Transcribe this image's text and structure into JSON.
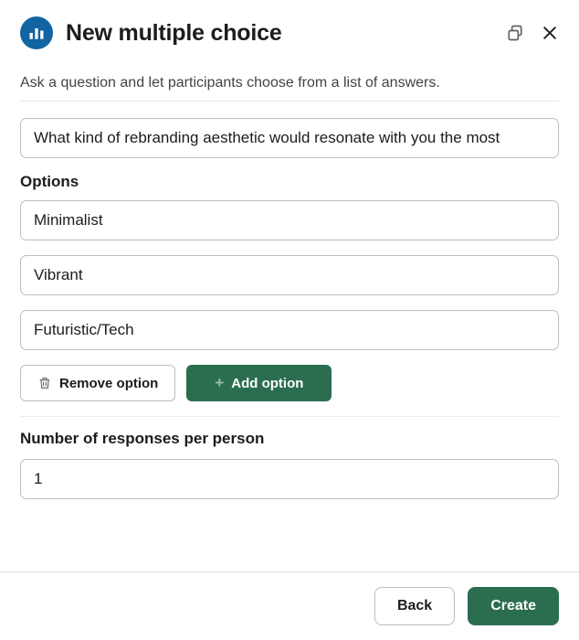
{
  "header": {
    "title": "New multiple choice"
  },
  "subtitle": "Ask a question and let participants choose from a list of answers.",
  "question": {
    "value": "What kind of rebranding aesthetic would resonate with you the most"
  },
  "options": {
    "label": "Options",
    "items": [
      {
        "value": "Minimalist"
      },
      {
        "value": "Vibrant"
      },
      {
        "value": "Futuristic/Tech"
      }
    ],
    "remove_label": "Remove option",
    "add_label": "Add option"
  },
  "responses": {
    "label": "Number of responses per person",
    "value": "1"
  },
  "footer": {
    "back_label": "Back",
    "create_label": "Create"
  }
}
